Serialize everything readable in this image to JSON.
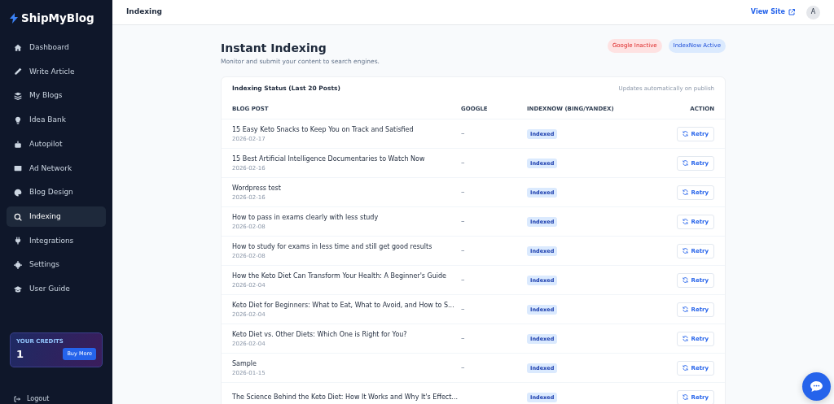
{
  "brand": {
    "name": "ShipMyBlog"
  },
  "sidebar": {
    "items": [
      {
        "label": "Dashboard",
        "selected": false
      },
      {
        "label": "Write Article",
        "selected": false
      },
      {
        "label": "My Blogs",
        "selected": false
      },
      {
        "label": "Idea Bank",
        "selected": false
      },
      {
        "label": "Autopilot",
        "selected": false
      },
      {
        "label": "Ad Network",
        "selected": false
      },
      {
        "label": "Blog Design",
        "selected": false
      },
      {
        "label": "Indexing",
        "selected": true
      },
      {
        "label": "Integrations",
        "selected": false
      },
      {
        "label": "Settings",
        "selected": false
      },
      {
        "label": "User Guide",
        "selected": false
      }
    ],
    "credits": {
      "label": "YOUR CREDITS",
      "value": "1",
      "button": "Buy More"
    },
    "logout": "Logout"
  },
  "header": {
    "title": "Indexing",
    "view_site": "View Site",
    "avatar": "A"
  },
  "page": {
    "title": "Instant Indexing",
    "subtitle": "Monitor and submit your content to search engines.",
    "badges": [
      {
        "label": "Google Inactive",
        "active": false
      },
      {
        "label": "IndexNow Active",
        "active": true
      }
    ]
  },
  "table": {
    "title": "Indexing Status (Last 20 Posts)",
    "note": "Updates automatically on publish",
    "columns": [
      "BLOG POST",
      "GOOGLE",
      "INDEXNOW (BING/YANDEX)",
      "ACTION"
    ],
    "rows": [
      {
        "title": "15 Easy Keto Snacks to Keep You on Track and Satisfied",
        "date": "2026-02-17",
        "google": "–",
        "indexnow": "Indexed",
        "action": "Retry"
      },
      {
        "title": "15 Best Artificial Intelligence Documentaries to Watch Now",
        "date": "2026-02-16",
        "google": "–",
        "indexnow": "Indexed",
        "action": "Retry"
      },
      {
        "title": "Wordpress test",
        "date": "2026-02-16",
        "google": "–",
        "indexnow": "Indexed",
        "action": "Retry"
      },
      {
        "title": "How to pass in exams clearly with less study",
        "date": "2026-02-08",
        "google": "–",
        "indexnow": "Indexed",
        "action": "Retry"
      },
      {
        "title": "How to study for exams in less time and still get good results",
        "date": "2026-02-08",
        "google": "–",
        "indexnow": "Indexed",
        "action": "Retry"
      },
      {
        "title": "How the Keto Diet Can Transform Your Health: A Beginner's Guide",
        "date": "2026-02-04",
        "google": "–",
        "indexnow": "Indexed",
        "action": "Retry"
      },
      {
        "title": "Keto Diet for Beginners: What to Eat, What to Avoid, and How to S...",
        "date": "2026-02-04",
        "google": "–",
        "indexnow": "Indexed",
        "action": "Retry"
      },
      {
        "title": "Keto Diet vs. Other Diets: Which One is Right for You?",
        "date": "2026-02-04",
        "google": "–",
        "indexnow": "Indexed",
        "action": "Retry"
      },
      {
        "title": "Sample",
        "date": "2026-01-15",
        "google": "–",
        "indexnow": "Indexed",
        "action": "Retry"
      },
      {
        "title": "The Science Behind the Keto Diet: How It Works and Why It's Effect...",
        "indexnow": "Indexed",
        "action": "Retry"
      }
    ]
  }
}
